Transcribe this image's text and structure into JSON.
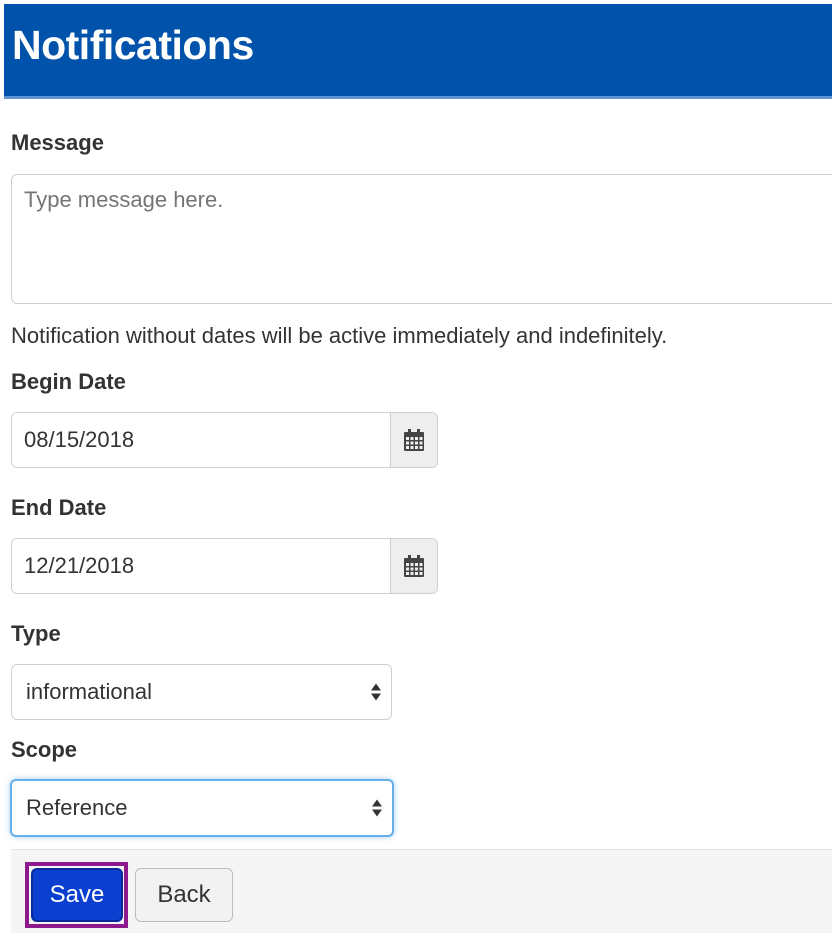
{
  "header": {
    "title": "Notifications"
  },
  "message": {
    "label": "Message",
    "placeholder": "Type message here."
  },
  "help_text": "Notification without dates will be active immediately and indefinitely.",
  "begin_date": {
    "label": "Begin Date",
    "value": "08/15/2018",
    "icon": "calendar-icon"
  },
  "end_date": {
    "label": "End Date",
    "value": "12/21/2018",
    "icon": "calendar-icon"
  },
  "type": {
    "label": "Type",
    "selected": "informational"
  },
  "scope": {
    "label": "Scope",
    "selected": "Reference"
  },
  "footer": {
    "save_label": "Save",
    "back_label": "Back"
  },
  "colors": {
    "header_bg": "#0152ab",
    "save_bg": "#0a3fcf",
    "highlight": "#8c1a8c",
    "focus": "#66afe9"
  }
}
